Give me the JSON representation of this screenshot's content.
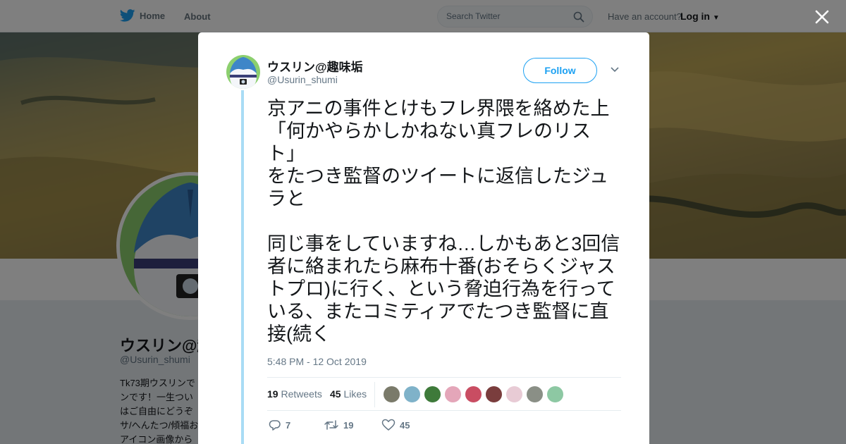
{
  "nav": {
    "home_label": "Home",
    "about_label": "About",
    "have_account": "Have an account?",
    "login_label": "Log in"
  },
  "search": {
    "placeholder": "Search Twitter"
  },
  "background_profile": {
    "name": "ウスリン@趣味垢",
    "handle": "@Usurin_shumi",
    "bio_lines": [
      "Tk73期ウスリンで",
      "ンです！一生つい",
      "はご自由にどうぞ",
      "サ/へんたつ/傾福お",
      "アイコン画像から"
    ]
  },
  "tweet": {
    "author_name": "ウスリン@趣味垢",
    "author_handle": "@Usurin_shumi",
    "follow_label": "Follow",
    "text": "京アニの事件とけもフレ界隈を絡めた上\n「何かやらかしかねない真フレのリスト」\nをたつき監督のツイートに返信したジュラと\n\n同じ事をしていますね…しかもあと3回信者に絡まれたら麻布十番(おそらくジャストプロ)に行く、という脅迫行為を行っている、またコミティアでたつき監督に直接(続く",
    "timestamp": "5:48 PM - 12 Oct 2019",
    "retweets": {
      "count": "19",
      "label": "Retweets"
    },
    "likes": {
      "count": "45",
      "label": "Likes"
    },
    "actions": {
      "replies": "7",
      "retweets": "19",
      "likes": "45"
    }
  },
  "liker_avatars": [
    {
      "icon": "liker-avatar",
      "color": "#7a7a6a"
    },
    {
      "icon": "liker-avatar",
      "color": "#7fb2c9"
    },
    {
      "icon": "liker-avatar",
      "color": "#3e7a3a"
    },
    {
      "icon": "liker-avatar",
      "color": "#e4a6b9"
    },
    {
      "icon": "liker-avatar",
      "color": "#c94d62"
    },
    {
      "icon": "liker-avatar",
      "color": "#7a3d3d"
    },
    {
      "icon": "liker-avatar",
      "color": "#e8cbd5"
    },
    {
      "icon": "liker-avatar",
      "color": "#8a8f86"
    },
    {
      "icon": "liker-avatar",
      "color": "#8dc8a3"
    }
  ],
  "colors": {
    "accent": "#1da1f2",
    "thread_line": "#a9dcf5",
    "muted_text": "#657786"
  }
}
